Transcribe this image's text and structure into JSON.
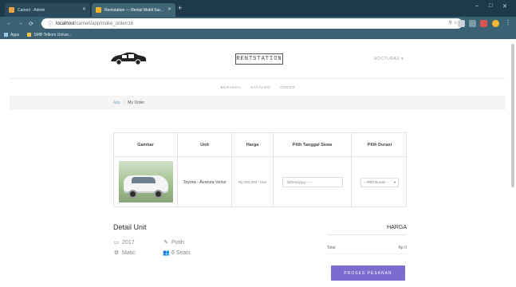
{
  "browser": {
    "tabs": [
      {
        "title": "Cameri - Admin",
        "favicon_color": "#e8a33d"
      },
      {
        "title": "Rentstation — Rental Mobil Sur...",
        "favicon_color": "#f0b429"
      }
    ],
    "new_tab": "+",
    "window_controls": {
      "minimize": "–",
      "maximize": "□",
      "close": "✕"
    },
    "url_host": "localhost",
    "url_path": "/cameri/app/make_order/16",
    "bookmarks": [
      "Apps",
      "SMB Telkom Univer..."
    ]
  },
  "site": {
    "brand": "RENTSTATION",
    "user_menu": "NOCTURAX ▾",
    "menu": [
      "BERANDA",
      "KATALOG",
      "ORDER"
    ],
    "breadcrumb": {
      "home": "App",
      "current": "My Order"
    }
  },
  "order_table": {
    "headers": [
      "Gambar",
      "Unit",
      "Harga",
      "Pilih Tanggal Sewa",
      "Pilih Durasi"
    ],
    "row": {
      "unit": "Toyota - Avanza Veloz",
      "harga": "Rp 250,000 / Hari",
      "date_placeholder": "dd/mm/yyyy --:--",
      "durasi_placeholder": "-- Pilih Durasi --"
    }
  },
  "detail": {
    "title": "Detail Unit",
    "year": "2017",
    "color": "Putih",
    "transmission": "Matic",
    "seats": "6 Seats"
  },
  "summary": {
    "harga_label": "HARGA",
    "total_label": "Total",
    "total_value": "Rp 0",
    "submit_label": "PROSES PESANAN"
  }
}
